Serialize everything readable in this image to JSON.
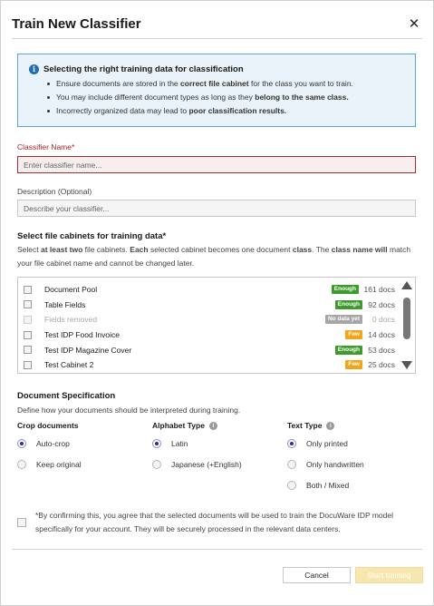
{
  "dialog": {
    "title": "Train New Classifier",
    "close_glyph": "✕"
  },
  "info": {
    "icon_glyph": "i",
    "title": "Selecting the right training data for classification",
    "bullets": [
      [
        {
          "t": "Ensure documents are stored in the ",
          "b": false
        },
        {
          "t": "correct file cabinet",
          "b": true
        },
        {
          "t": " for the class you want to train.",
          "b": false
        }
      ],
      [
        {
          "t": "You may include different document types as long as they ",
          "b": false
        },
        {
          "t": "belong to the same class.",
          "b": true
        }
      ],
      [
        {
          "t": "Incorrectly organized data may lead to ",
          "b": false
        },
        {
          "t": "poor classification results.",
          "b": true
        }
      ]
    ]
  },
  "classifier_name": {
    "label": "Classifier Name*",
    "placeholder": "Enter classifier name..."
  },
  "description": {
    "label": "Description (Optional)",
    "placeholder": "Describe your classifier..."
  },
  "cabinets": {
    "title": "Select file cabinets for training data*",
    "subtitle": [
      {
        "t": "Select ",
        "b": false
      },
      {
        "t": "at least two",
        "b": true
      },
      {
        "t": " file cabinets. ",
        "b": false
      },
      {
        "t": "Each",
        "b": true
      },
      {
        "t": " selected cabinet becomes one document ",
        "b": false
      },
      {
        "t": "class",
        "b": true
      },
      {
        "t": ". The ",
        "b": false
      },
      {
        "t": "class name will",
        "b": true
      },
      {
        "t": " match your file cabinet name and cannot be changed later.",
        "b": false
      }
    ],
    "items": [
      {
        "name": "Document Pool",
        "badge": "Enough",
        "badge_color": "#3d9a2c",
        "docs": "161 docs",
        "disabled": false
      },
      {
        "name": "Table Fields",
        "badge": "Enough",
        "badge_color": "#3d9a2c",
        "docs": "92 docs",
        "disabled": false
      },
      {
        "name": "Fields removed",
        "badge": "No data yet",
        "badge_color": "#a6a6a6",
        "docs": "0 docs",
        "disabled": true
      },
      {
        "name": "Test IDP Food Invoice",
        "badge": "Few",
        "badge_color": "#f2a51a",
        "docs": "14 docs",
        "disabled": false
      },
      {
        "name": "Test IDP Magazine Cover",
        "badge": "Enough",
        "badge_color": "#3d9a2c",
        "docs": "53 docs",
        "disabled": false
      },
      {
        "name": "Test Cabinet 2",
        "badge": "Few",
        "badge_color": "#f2a51a",
        "docs": "25 docs",
        "disabled": false
      }
    ]
  },
  "spec": {
    "title": "Document Specification",
    "subtitle": "Define how your documents should be interpreted during training.",
    "help_glyph": "i",
    "groups": [
      {
        "label": "Crop documents",
        "options": [
          "Auto-crop",
          "Keep original"
        ],
        "selected": 0
      },
      {
        "label": "Alphabet Type",
        "options": [
          "Latin",
          "Japanese (+English)"
        ],
        "selected": 0
      },
      {
        "label": "Text Type",
        "options": [
          "Only printed",
          "Only handwritten",
          "Both / Mixed"
        ],
        "selected": 0
      }
    ]
  },
  "consent": {
    "text": "*By confirming this, you agree that the selected documents will be used to train the DocuWare IDP model specifically for your account. They will be securely processed in the relevant data centers."
  },
  "footer": {
    "cancel_label": "Cancel",
    "start_label": "Start training"
  },
  "colors": {
    "accent": "#1e6fb5",
    "error": "#a82222",
    "enough": "#3d9a2c",
    "few": "#f2a51a",
    "no_data": "#a6a6a6",
    "start_disabled": "#f7e6ad"
  }
}
